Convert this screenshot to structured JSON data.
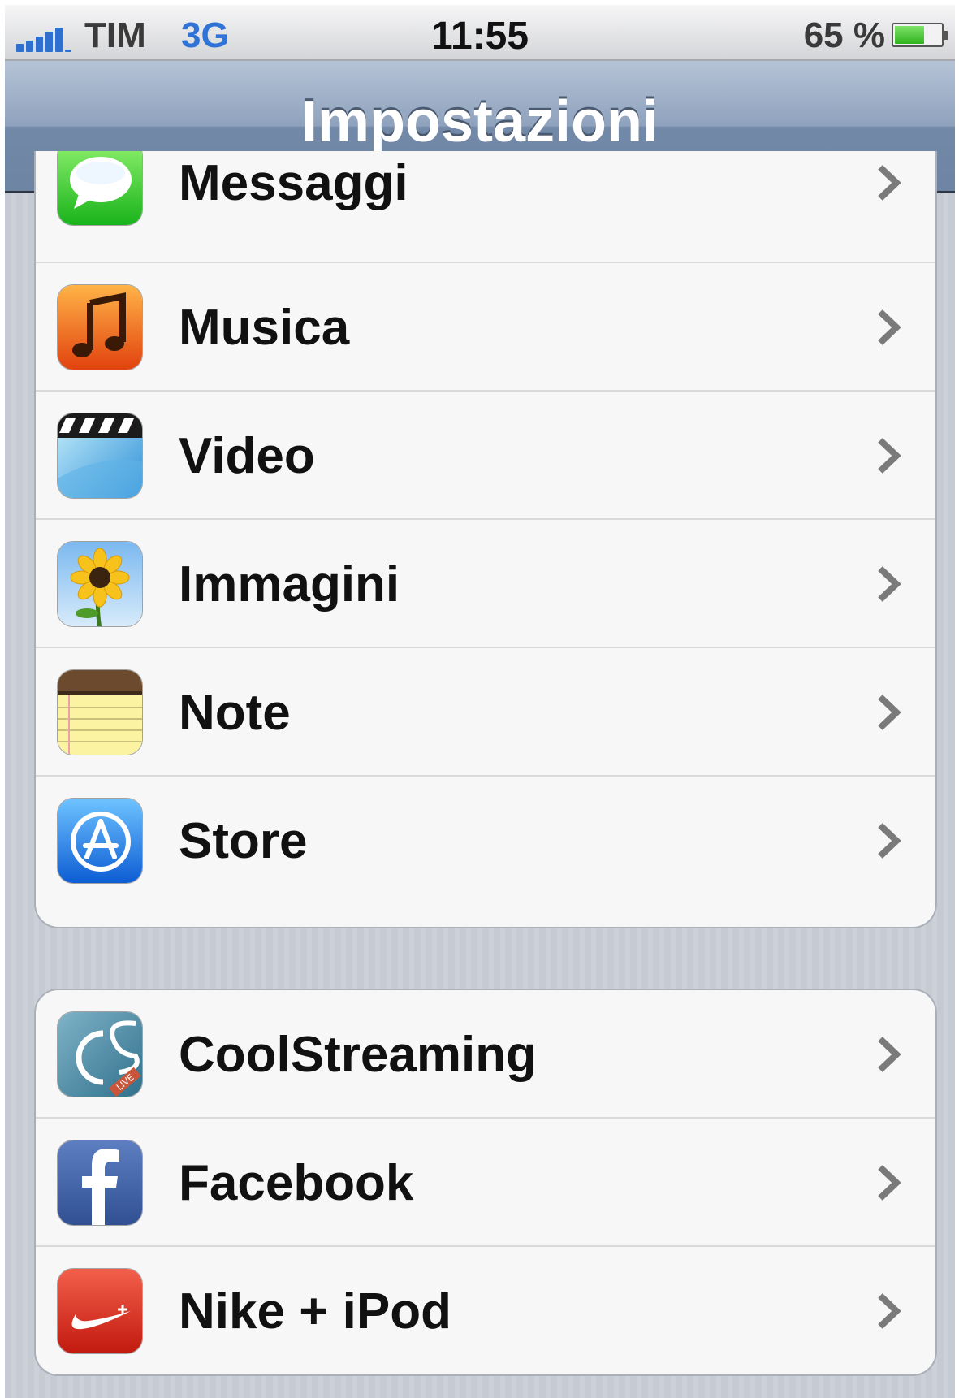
{
  "status_bar": {
    "carrier": "TIM",
    "network": "3G",
    "time": "11:55",
    "battery_percent_text": "65 %",
    "battery_level": 0.65,
    "signal_bars": 5
  },
  "nav": {
    "title": "Impostazioni"
  },
  "groups": [
    {
      "items": [
        {
          "label": "Messaggi",
          "icon": "messages-icon"
        },
        {
          "label": "Musica",
          "icon": "music-icon"
        },
        {
          "label": "Video",
          "icon": "video-icon"
        },
        {
          "label": "Immagini",
          "icon": "photos-icon"
        },
        {
          "label": "Note",
          "icon": "notes-icon"
        },
        {
          "label": "Store",
          "icon": "app-store-icon"
        }
      ]
    },
    {
      "items": [
        {
          "label": "CoolStreaming",
          "icon": "coolstreaming-icon",
          "badge": "LIVE"
        },
        {
          "label": "Facebook",
          "icon": "facebook-icon"
        },
        {
          "label": "Nike + iPod",
          "icon": "nike-ipod-icon"
        }
      ]
    }
  ],
  "colors": {
    "nav_bar": "#7a8fae",
    "network_text": "#2f73d6",
    "battery_fill": "#3cc12a"
  }
}
